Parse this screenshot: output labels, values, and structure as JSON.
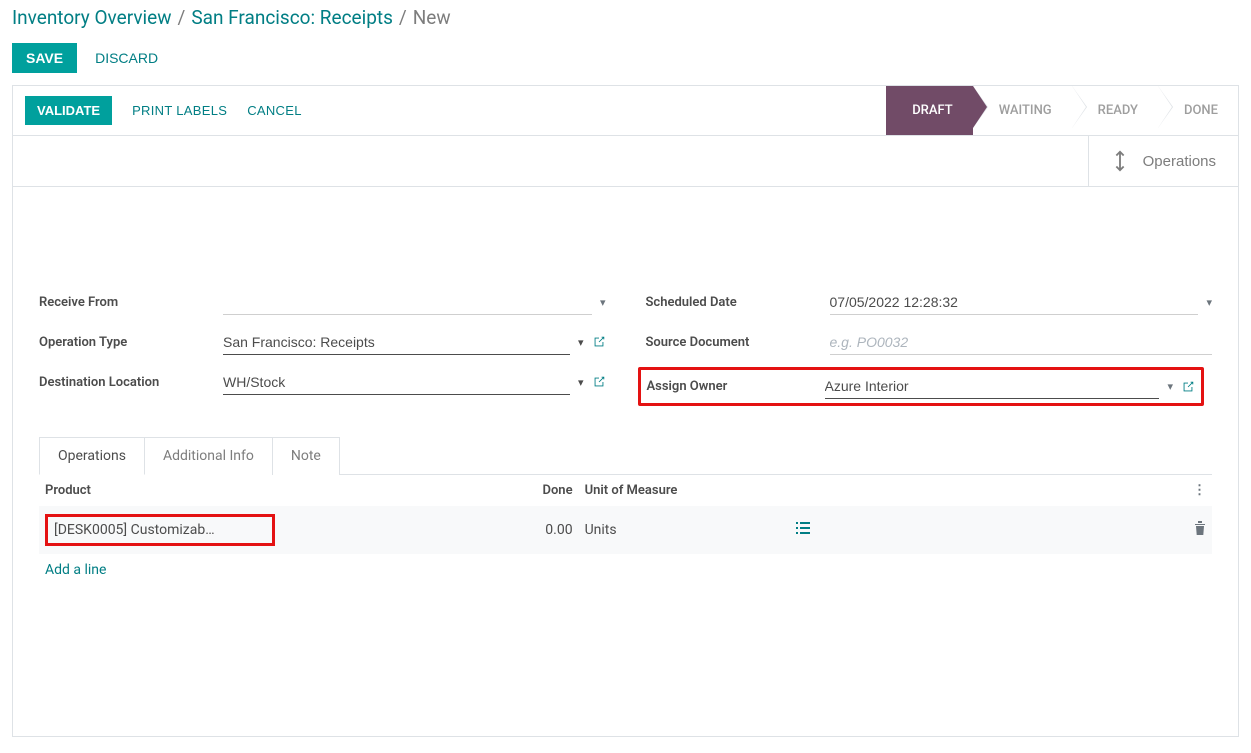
{
  "breadcrumb": {
    "level1": "Inventory Overview",
    "level2": "San Francisco: Receipts",
    "current": "New"
  },
  "actions": {
    "save": "SAVE",
    "discard": "DISCARD"
  },
  "toolbar": {
    "validate": "VALIDATE",
    "print_labels": "PRINT LABELS",
    "cancel": "CANCEL"
  },
  "status": {
    "draft": "DRAFT",
    "waiting": "WAITING",
    "ready": "READY",
    "done": "DONE"
  },
  "operations_button": "Operations",
  "fields": {
    "receive_from": {
      "label": "Receive From",
      "value": ""
    },
    "operation_type": {
      "label": "Operation Type",
      "value": "San Francisco: Receipts"
    },
    "destination": {
      "label": "Destination Location",
      "value": "WH/Stock"
    },
    "scheduled": {
      "label": "Scheduled Date",
      "value": "07/05/2022 12:28:32"
    },
    "source_doc": {
      "label": "Source Document",
      "placeholder": "e.g. PO0032",
      "value": ""
    },
    "assign_owner": {
      "label": "Assign Owner",
      "value": "Azure Interior"
    }
  },
  "tabs": {
    "operations": "Operations",
    "additional": "Additional Info",
    "note": "Note"
  },
  "table": {
    "headers": {
      "product": "Product",
      "done": "Done",
      "uom": "Unit of Measure"
    },
    "row": {
      "product": "[DESK0005] Customizab…",
      "done": "0.00",
      "uom": "Units"
    },
    "add_line": "Add a line"
  }
}
